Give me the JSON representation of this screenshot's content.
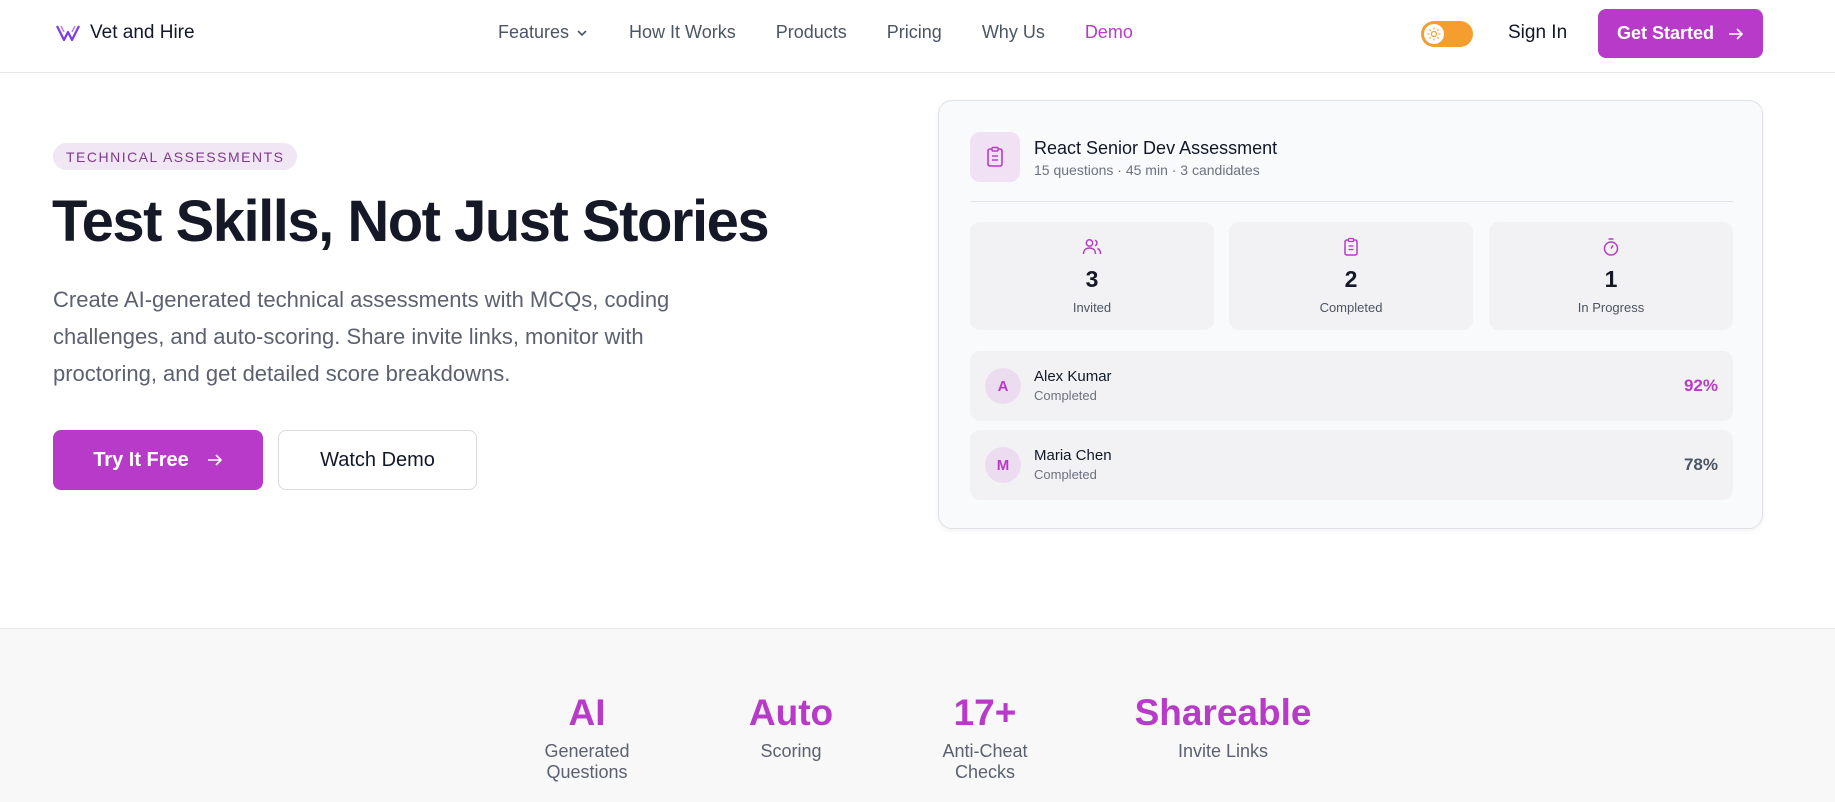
{
  "nav": {
    "brand": "Vet and Hire",
    "links": [
      {
        "label": "Features",
        "has_dropdown": true,
        "active": false
      },
      {
        "label": "How It Works",
        "active": false
      },
      {
        "label": "Products",
        "active": false
      },
      {
        "label": "Pricing",
        "active": false
      },
      {
        "label": "Why Us",
        "active": false
      },
      {
        "label": "Demo",
        "active": true
      }
    ],
    "theme_toggle": "sun-icon",
    "sign_in": "Sign In",
    "get_started": "Get Started"
  },
  "hero": {
    "badge": "TECHNICAL ASSESSMENTS",
    "title": "Test Skills, Not Just Stories",
    "description": "Create AI-generated technical assessments with MCQs, coding challenges, and auto-scoring. Share invite links, monitor with proctoring, and get detailed score breakdowns.",
    "primary_button": "Try It Free",
    "secondary_button": "Watch Demo"
  },
  "assessment_card": {
    "title": "React Senior Dev Assessment",
    "subtitle": "15 questions · 45 min · 3 candidates",
    "stats": [
      {
        "icon": "users-icon",
        "value": "3",
        "label": "Invited"
      },
      {
        "icon": "clipboard-icon",
        "value": "2",
        "label": "Completed"
      },
      {
        "icon": "timer-icon",
        "value": "1",
        "label": "In Progress"
      }
    ],
    "candidates": [
      {
        "initial": "A",
        "name": "Alex Kumar",
        "status": "Completed",
        "score": "92%",
        "score_color": "#b73bc8"
      },
      {
        "initial": "M",
        "name": "Maria Chen",
        "status": "Completed",
        "score": "78%",
        "score_color": "#4b5563"
      }
    ]
  },
  "highlights": [
    {
      "value": "AI",
      "label": "Generated Questions"
    },
    {
      "value": "Auto",
      "label": "Scoring"
    },
    {
      "value": "17+",
      "label": "Anti-Cheat Checks"
    },
    {
      "value": "Shareable",
      "label": "Invite Links"
    }
  ],
  "colors": {
    "accent": "#b73bc8",
    "toggle": "#f59e2f"
  }
}
